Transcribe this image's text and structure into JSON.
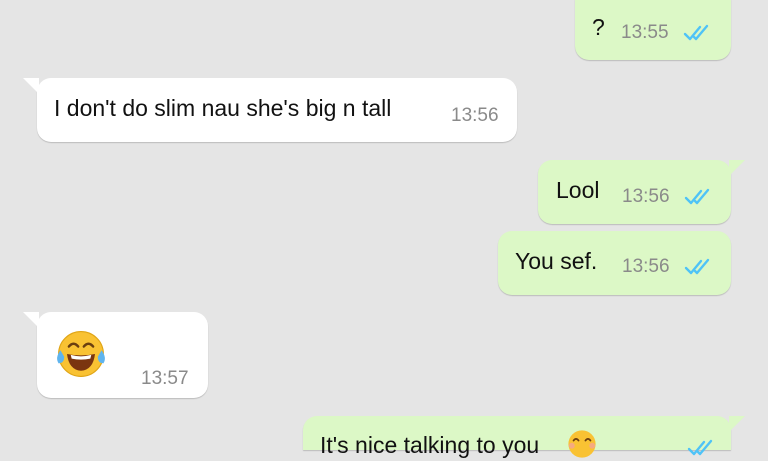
{
  "messages": [
    {
      "direction": "outgoing",
      "text": "?",
      "time": "13:55",
      "status": "read"
    },
    {
      "direction": "incoming",
      "text": "I don't do slim nau she's big n tall",
      "time": "13:56"
    },
    {
      "direction": "outgoing",
      "text": "Lool",
      "time": "13:56",
      "status": "read"
    },
    {
      "direction": "outgoing",
      "text": "You sef.",
      "time": "13:56",
      "status": "read"
    },
    {
      "direction": "incoming",
      "emoji": "face-with-tears-of-joy",
      "time": "13:57"
    },
    {
      "direction": "outgoing",
      "text": "It's nice talking to you",
      "emoji": "smiling-face-with-smiling-eyes",
      "status": "read"
    }
  ],
  "colors": {
    "background": "#e5e5e5",
    "outgoing_bubble": "#dcf8c6",
    "incoming_bubble": "#ffffff",
    "read_ticks": "#4fc3f7",
    "timestamp": "#8a8a8a"
  }
}
